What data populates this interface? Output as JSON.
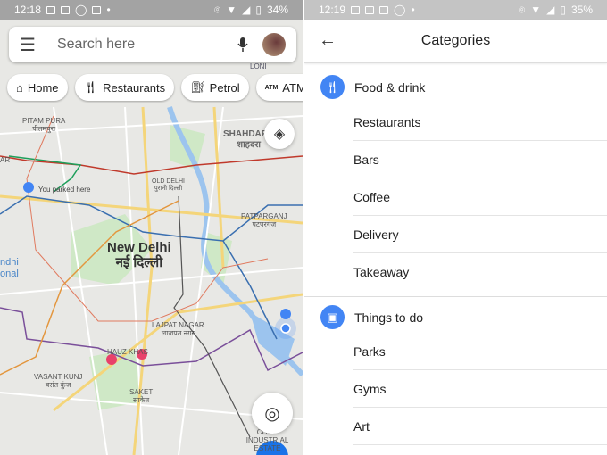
{
  "left": {
    "status": {
      "time": "12:18",
      "battery": "34%"
    },
    "search": {
      "placeholder": "Search here"
    },
    "chips": [
      {
        "icon": "home-icon",
        "label": "Home"
      },
      {
        "icon": "fork-knife-icon",
        "label": "Restaurants"
      },
      {
        "icon": "fuel-pump-icon",
        "label": "Petrol"
      },
      {
        "icon": "atm-icon",
        "icon_text": "ATM",
        "label": "ATMs"
      }
    ],
    "map_labels": {
      "loni": "LONI",
      "pitampura": "PITAM PURA",
      "pitampura_hi": "पीतमपुरा",
      "shahdara": "SHAHDARA",
      "shahdara_hi": "शाहदरा",
      "ar": "AR",
      "parked": "You parked here",
      "old_delhi": "OLD DELHI",
      "old_delhi_hi": "पुरानी दिल्ली",
      "patparganj": "PATPARGANJ",
      "patparganj_hi": "पटपरगंज",
      "new_delhi": "New Delhi",
      "new_delhi_hi": "नई दिल्ली",
      "gandhi": "ndhi",
      "national": "onal",
      "lajpat": "LAJPAT NAGAR",
      "lajpat_hi": "लाजपत नगर",
      "hauz": "HAUZ KHAS",
      "vasant": "VASANT KUNJ",
      "vasant_hi": "वसंत कुंज",
      "saket": "SAKET",
      "saket_hi": "साकेत",
      "coop": "COOP",
      "industrial": "INDUSTRIAL ESTATE"
    }
  },
  "right": {
    "status": {
      "time": "12:19",
      "battery": "35%"
    },
    "title": "Categories",
    "sections": [
      {
        "icon": "fork-knife-icon",
        "label": "Food & drink",
        "items": [
          "Restaurants",
          "Bars",
          "Coffee",
          "Delivery",
          "Takeaway"
        ]
      },
      {
        "icon": "ticket-icon",
        "label": "Things to do",
        "items": [
          "Parks",
          "Gyms",
          "Art"
        ]
      }
    ]
  },
  "colors": {
    "accent": "#4285f4",
    "pin_pink": "#e8416a"
  }
}
